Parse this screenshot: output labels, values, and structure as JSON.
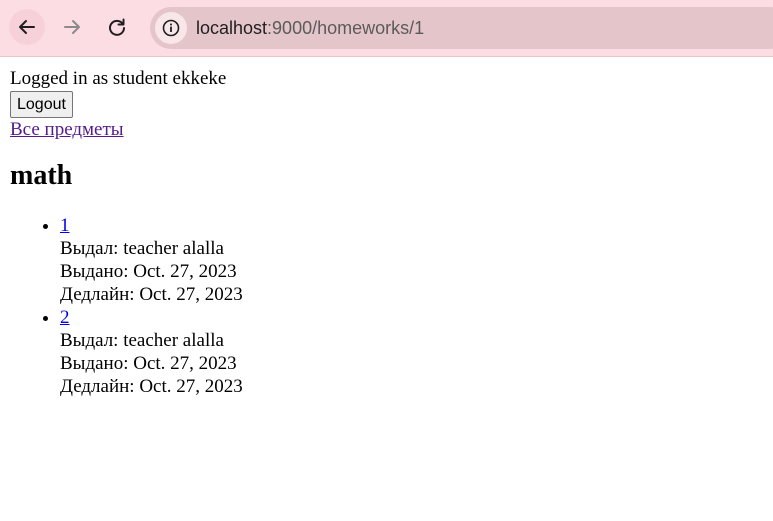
{
  "browser": {
    "url_host": "localhost",
    "url_rest": ":9000/homeworks/1"
  },
  "page": {
    "login_text": "Logged in as student ekkeke",
    "logout_label": "Logout",
    "all_subjects_link": "Все предметы",
    "subject_title": "math",
    "homeworks": [
      {
        "number": "1",
        "issuer": "Выдал: teacher alalla",
        "issued": "Выдано: Oct. 27, 2023",
        "deadline": "Дедлайн: Oct. 27, 2023"
      },
      {
        "number": "2",
        "issuer": "Выдал: teacher alalla",
        "issued": "Выдано: Oct. 27, 2023",
        "deadline": "Дедлайн: Oct. 27, 2023"
      }
    ]
  },
  "icons": {
    "back": "arrow-left-icon",
    "forward": "arrow-right-icon",
    "reload": "reload-icon",
    "site_info": "info-icon"
  },
  "colors": {
    "toolbar_bg": "#fddde4",
    "omnibox_bg": "#e4c5ca",
    "visited_link": "#551a8b",
    "link": "#0000ee"
  }
}
